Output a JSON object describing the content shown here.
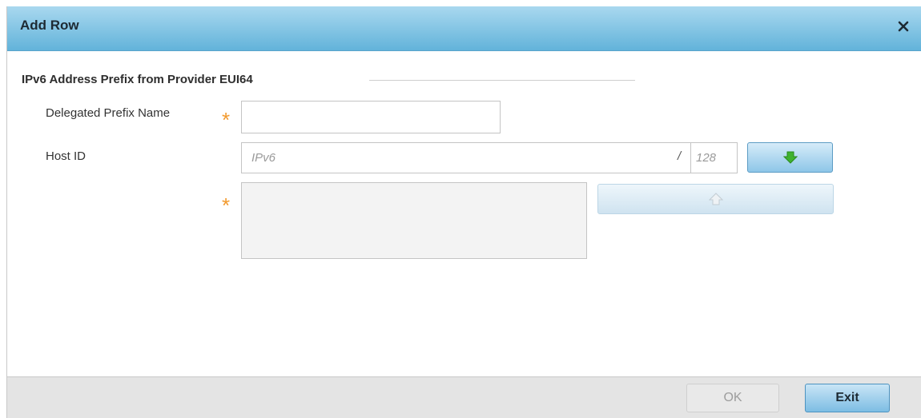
{
  "dialog": {
    "title": "Add Row",
    "close_icon": "close-icon"
  },
  "section": {
    "title": "IPv6 Address Prefix from Provider EUI64"
  },
  "form": {
    "delegated_prefix_name": {
      "label": "Delegated Prefix Name",
      "value": "",
      "required": true
    },
    "host_id": {
      "label": "Host ID",
      "placeholder": "IPv6",
      "separator": "/",
      "prefix_length_placeholder": "128",
      "add_icon": "arrow-down-icon",
      "remove_icon": "arrow-up-icon",
      "list_required": true,
      "entries": []
    }
  },
  "footer": {
    "ok_label": "OK",
    "exit_label": "Exit"
  },
  "colors": {
    "title_bar": "#62b3da",
    "required_star": "#f29a2e",
    "add_arrow": "#3fb22f"
  }
}
